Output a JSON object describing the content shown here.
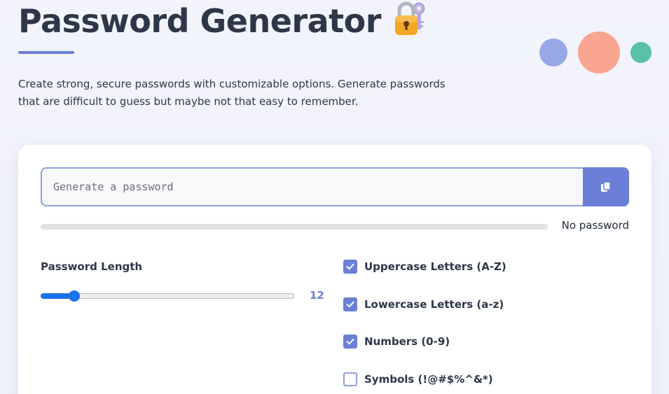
{
  "header": {
    "title": "Password Generator",
    "subtitle": "Create strong, secure passwords with customizable options. Generate passwords that are difficult to guess but maybe not that easy to remember.",
    "icon": "locked-with-key-icon"
  },
  "decor": {
    "dot_colors": [
      "#98a8e6",
      "#f9a591",
      "#58c0a9"
    ]
  },
  "generator": {
    "password_value": "",
    "password_placeholder": "Generate a password",
    "copy_icon": "copy-icon",
    "strength_label": "No password",
    "strength_fraction": 0,
    "length_label": "Password Length",
    "length_value": "12",
    "length_min": 4,
    "length_max": 64,
    "options": [
      {
        "label": "Uppercase Letters (A-Z)",
        "checked": true
      },
      {
        "label": "Lowercase Letters (a-z)",
        "checked": true
      },
      {
        "label": "Numbers (0-9)",
        "checked": true
      },
      {
        "label": "Symbols (!@#$%^&*)",
        "checked": false
      }
    ]
  },
  "colors": {
    "accent": "#6b7fd7",
    "slider": "#1a73e8",
    "text": "#2d3748"
  }
}
